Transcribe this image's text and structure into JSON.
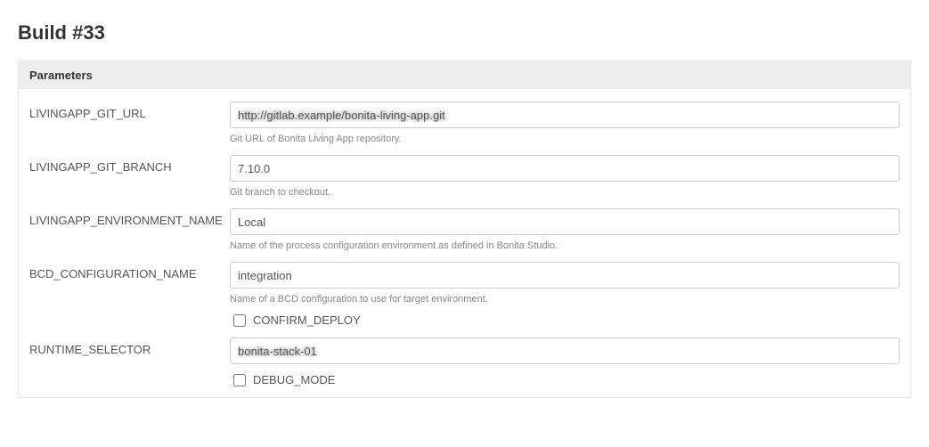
{
  "page_title": "Build #33",
  "panel": {
    "header": "Parameters"
  },
  "params": {
    "livingapp_git_url": {
      "label": "LIVINGAPP_GIT_URL",
      "value": "",
      "redacted_placeholder": "http://gitlab.example/bonita-living-app.git",
      "help": "Git URL of Bonita Living App repository."
    },
    "livingapp_git_branch": {
      "label": "LIVINGAPP_GIT_BRANCH",
      "value": "7.10.0",
      "help": "Git branch to checkout."
    },
    "livingapp_environment_name": {
      "label": "LIVINGAPP_ENVIRONMENT_NAME",
      "value": "Local",
      "help": "Name of the process configuration environment as defined in Bonita Studio."
    },
    "bcd_configuration_name": {
      "label": "BCD_CONFIGURATION_NAME",
      "value": "integration",
      "help": "Name of a BCD configuration to use for target environment."
    },
    "confirm_deploy": {
      "label": "CONFIRM_DEPLOY",
      "checked": false
    },
    "runtime_selector": {
      "label": "RUNTIME_SELECTOR",
      "value": "",
      "redacted_placeholder": "bonita-stack-01"
    },
    "debug_mode": {
      "label": "DEBUG_MODE",
      "checked": false
    }
  }
}
